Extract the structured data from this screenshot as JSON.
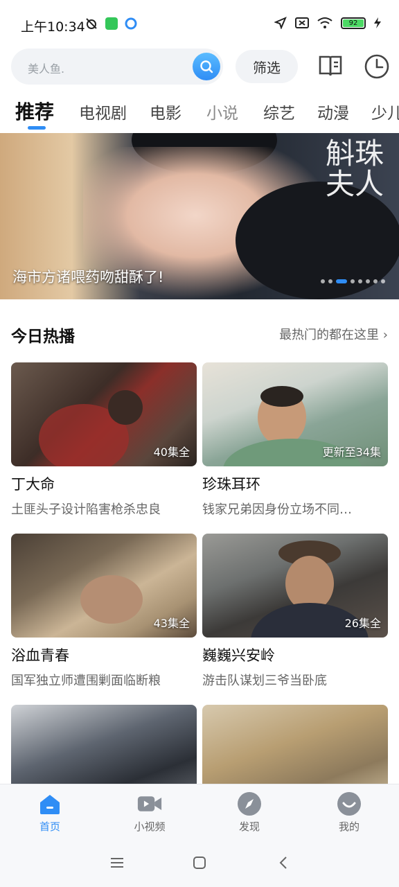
{
  "status_bar": {
    "time": "上午10:34",
    "battery": "92"
  },
  "search": {
    "placeholder": "美人鱼.",
    "filter_label": "筛选"
  },
  "tabs": [
    {
      "label": "推荐",
      "active": true
    },
    {
      "label": "电视剧"
    },
    {
      "label": "电影"
    },
    {
      "label": "小说"
    },
    {
      "label": "综艺"
    },
    {
      "label": "动漫"
    },
    {
      "label": "少儿"
    }
  ],
  "banner": {
    "caption": "海市方诸喂药吻甜酥了!",
    "title_art": "斛珠夫人",
    "slide_count": 8,
    "active_slide": 3
  },
  "section": {
    "title": "今日热播",
    "more_label": "最热门的都在这里"
  },
  "cards": [
    {
      "name": "丁大命",
      "desc": "土匪头子设计陷害枪杀忠良",
      "episodes": "40集全"
    },
    {
      "name": "珍珠耳环",
      "desc": "钱家兄弟因身份立场不同…",
      "episodes": "更新至34集"
    },
    {
      "name": "浴血青春",
      "desc": "国军独立师遭围剿面临断粮",
      "episodes": "43集全"
    },
    {
      "name": "巍巍兴安岭",
      "desc": "游击队谋划三爷当卧底",
      "episodes": "26集全"
    }
  ],
  "bottom_nav": [
    {
      "label": "首页",
      "icon": "home-icon",
      "active": true
    },
    {
      "label": "小视频",
      "icon": "video-camera-icon"
    },
    {
      "label": "发现",
      "icon": "compass-icon"
    },
    {
      "label": "我的",
      "icon": "profile-icon"
    }
  ],
  "colors": {
    "accent": "#2f8df5",
    "inactive": "#8a9099"
  }
}
